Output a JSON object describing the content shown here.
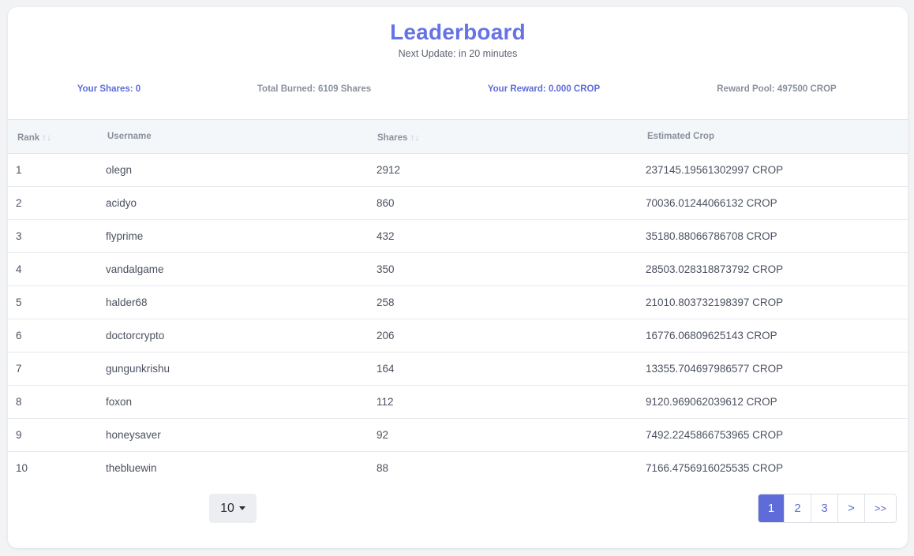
{
  "header": {
    "title": "Leaderboard",
    "next_update": "Next Update: in 20 minutes"
  },
  "stats": {
    "your_shares": "Your Shares: 0",
    "total_burned": "Total Burned: 6109 Shares",
    "your_reward": "Your Reward: 0.000 CROP",
    "reward_pool": "Reward Pool: 497500 CROP"
  },
  "table": {
    "columns": [
      "Rank",
      "Username",
      "Shares",
      "Estimated Crop"
    ],
    "sort_glyph": "↑↓",
    "rows": [
      {
        "rank": "1",
        "username": "olegn",
        "shares": "2912",
        "crop": "237145.19561302997 CROP"
      },
      {
        "rank": "2",
        "username": "acidyo",
        "shares": "860",
        "crop": "70036.01244066132 CROP"
      },
      {
        "rank": "3",
        "username": "flyprime",
        "shares": "432",
        "crop": "35180.88066786708 CROP"
      },
      {
        "rank": "4",
        "username": "vandalgame",
        "shares": "350",
        "crop": "28503.028318873792 CROP"
      },
      {
        "rank": "5",
        "username": "halder68",
        "shares": "258",
        "crop": "21010.803732198397 CROP"
      },
      {
        "rank": "6",
        "username": "doctorcrypto",
        "shares": "206",
        "crop": "16776.06809625143 CROP"
      },
      {
        "rank": "7",
        "username": "gungunkrishu",
        "shares": "164",
        "crop": "13355.704697986577 CROP"
      },
      {
        "rank": "8",
        "username": "foxon",
        "shares": "112",
        "crop": "9120.969062039612 CROP"
      },
      {
        "rank": "9",
        "username": "honeysaver",
        "shares": "92",
        "crop": "7492.2245866753965 CROP"
      },
      {
        "rank": "10",
        "username": "thebluewin",
        "shares": "88",
        "crop": "7166.4756916025535 CROP"
      }
    ]
  },
  "pagination": {
    "page_size": "10",
    "pages": [
      "1",
      "2",
      "3"
    ],
    "next": ">",
    "last": ">>",
    "active_page": "1"
  },
  "colors": {
    "accent": "#5e6bd8",
    "title": "#6673e6",
    "header_bg": "#f4f7fa"
  }
}
